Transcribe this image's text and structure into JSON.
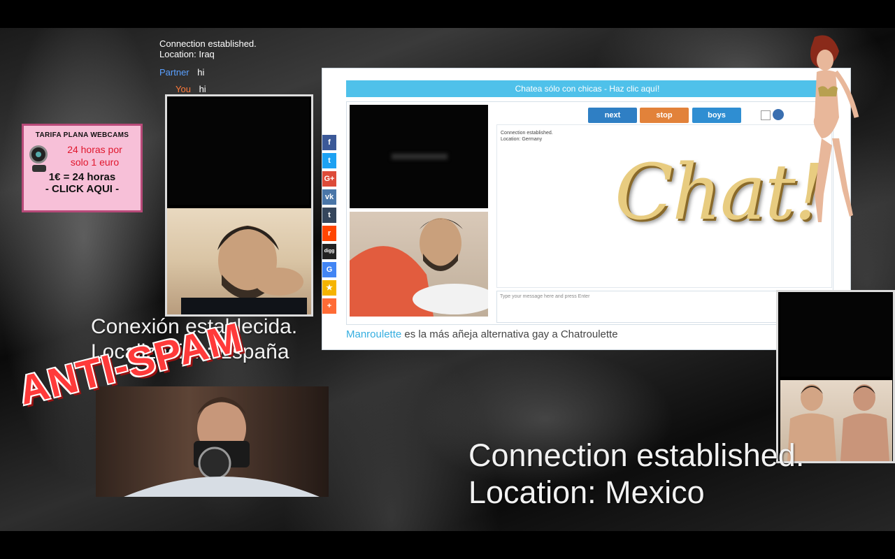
{
  "left_chat": {
    "status_line_1": "Connection established.",
    "status_line_2": "Location: Iraq",
    "partner_label": "Partner",
    "partner_message": "hi",
    "you_label": "You",
    "you_message": "hi"
  },
  "ad": {
    "title": "TARIFA PLANA WEBCAMS",
    "line1": "24 horas por",
    "line2": "solo 1 euro",
    "price": "1€ = 24 horas",
    "cta": "- CLICK AQUI -"
  },
  "overlay_spanish": {
    "line1": "Conexión establecida.",
    "line2": "Localización: España"
  },
  "anti_spam": "ANTI-SPAM",
  "overlay_english": {
    "line1": "Connection established.",
    "line2": "Location: Mexico"
  },
  "site": {
    "banner": "Chatea sólo con chicas - Haz clic aquí!",
    "buttons": {
      "next": "next",
      "stop": "stop",
      "boys": "boys"
    },
    "status_line_1": "Connection established.",
    "status_line_2": "Location: Germany",
    "logo_text": "Chat!",
    "input_placeholder": "Type your message here and press Enter",
    "tagline_brand": "Manroulette",
    "tagline_rest": " es la más añeja alternativa gay a Chatroulette",
    "share_icons": [
      {
        "glyph": "f",
        "color": "#3b5998"
      },
      {
        "glyph": "t",
        "color": "#1da1f2"
      },
      {
        "glyph": "G+",
        "color": "#dd4b39"
      },
      {
        "glyph": "vk",
        "color": "#4a76a8"
      },
      {
        "glyph": "t",
        "color": "#35465c"
      },
      {
        "glyph": "r",
        "color": "#ff4500"
      },
      {
        "glyph": "digg",
        "color": "#222222"
      },
      {
        "glyph": "G",
        "color": "#4285f4"
      },
      {
        "glyph": "★",
        "color": "#f5b400"
      },
      {
        "glyph": "+",
        "color": "#ff6b35"
      }
    ]
  }
}
